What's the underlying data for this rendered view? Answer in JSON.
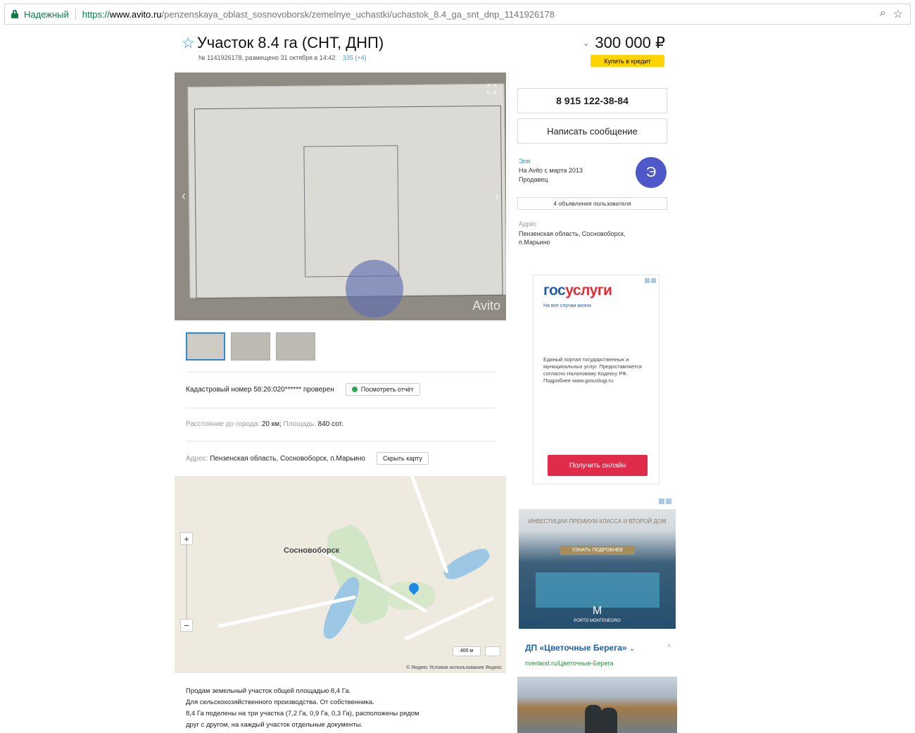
{
  "browser": {
    "secure_label": "Надежный",
    "url_scheme": "https://",
    "url_host": "www.avito.ru",
    "url_path": "/penzenskaya_oblast_sosnovoborsk/zemelnye_uchastki/uchastok_8.4_ga_snt_dnp_1141926178"
  },
  "listing": {
    "title": "Участок 8.4 га (СНТ, ДНП)",
    "meta": "№ 1141926178, размещено 31 октября в 14:42",
    "views": "335 (+4)",
    "price": "300 000 ₽",
    "credit_label": "Купить в кредит",
    "watermark": "Avito",
    "cadastral_text": "Кадастровый номер 58:26:020****** проверен",
    "report_button": "Посмотреть отчёт",
    "distance_label": "Расстояние до города:",
    "distance_value": "20 км;",
    "area_label": "Площадь:",
    "area_value": "840 сот.",
    "address_label": "Адрес:",
    "address_value": "Пензенская область, Сосновоборск, п.Марьино",
    "hide_map_button": "Скрыть карту",
    "description_lines": [
      "Продам земельный участок общей площадью 8,4 Га.",
      "Для сельскохозяйственного производства. От собственника.",
      "8,4 Га поделены на три участка (7,2 Га, 0,9 Га, 0,3 Га), расположены рядом",
      "друг с другом, на каждый участок отдельные документы."
    ]
  },
  "map": {
    "town_label": "Сосновоборск",
    "zoom_in": "+",
    "zoom_out": "−",
    "scale": "400 м",
    "footer": "© Яндекс Условия использования Яндекс"
  },
  "seller": {
    "phone": "8 915 122-38-84",
    "message_button": "Написать сообщение",
    "name": "Эля",
    "since": "На Avito с марта 2013",
    "role": "Продавец",
    "avatar_letter": "Э",
    "ads_button": "4 объявления пользователя",
    "address_label": "Адрес",
    "address_value": "Пензенская область, Сосновоборск, п.Марьино"
  },
  "ads": {
    "gos_a": "гос",
    "gos_b": "услуги",
    "gos_sub": "На все случаи жизни",
    "gos_text": "Единый портал государственных и муниципальных услуг. Предоставляется согласно Налоговому Кодексу РФ. Подробнее www.gosuslugi.ru",
    "gos_button": "Получить онлайн",
    "realty_text": "ИНВЕСТИЦИИ ПРЕМИУМ-КЛАССА И ВТОРОЙ ДОМ",
    "realty_button": "УЗНАТЬ ПОДРОБНЕЕ",
    "realty_logo": "M",
    "realty_logo_sub": "PORTO MONTENEGRO",
    "dp_title": "ДП «Цветочные Берега»",
    "dp_source": "riverland.ru/Цветочные-Берега"
  },
  "colors": {
    "accent_blue": "#2a8bd4",
    "credit_yellow": "#ffd400",
    "avatar": "#4e58c8",
    "gos_red": "#e02c37"
  }
}
